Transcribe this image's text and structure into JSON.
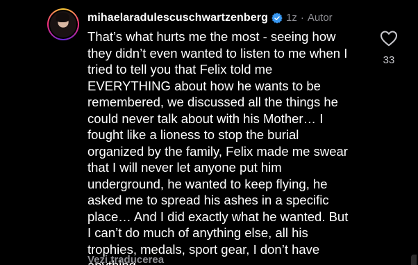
{
  "comment": {
    "username": "mihaelaradulescuschwartzenberg",
    "verified": true,
    "verified_icon": "verified-badge-icon",
    "timestamp": "1z",
    "separator": "·",
    "author_label": "Autor",
    "text": "That’s what hurts me the most - seeing how\nthey didn’t even wanted to listen to me when I\ntried to tell you that Felix told me\nEVERYTHING about how he wants to be\nremembered, we discussed all the things he\ncould never talk about with his Mother… I\nfought like a lioness to stop the burial\norganized by the family, Felix made me swear\nthat I will never let anyone put him\nunderground, he wanted to keep flying, he\nasked me to spread his ashes in a specific\nplace… And I did exactly what he wanted. But\nI can’t do much of anything else, all his\ntrophies, medals, sport gear, I don’t have\nanything…",
    "translate_link": "Vezi traducerea",
    "like_icon": "heart-outline-icon",
    "like_count": "33"
  },
  "colors": {
    "background": "#000000",
    "text": "#ffffff",
    "muted": "#8e8e93",
    "verified_blue": "#3897f0"
  }
}
